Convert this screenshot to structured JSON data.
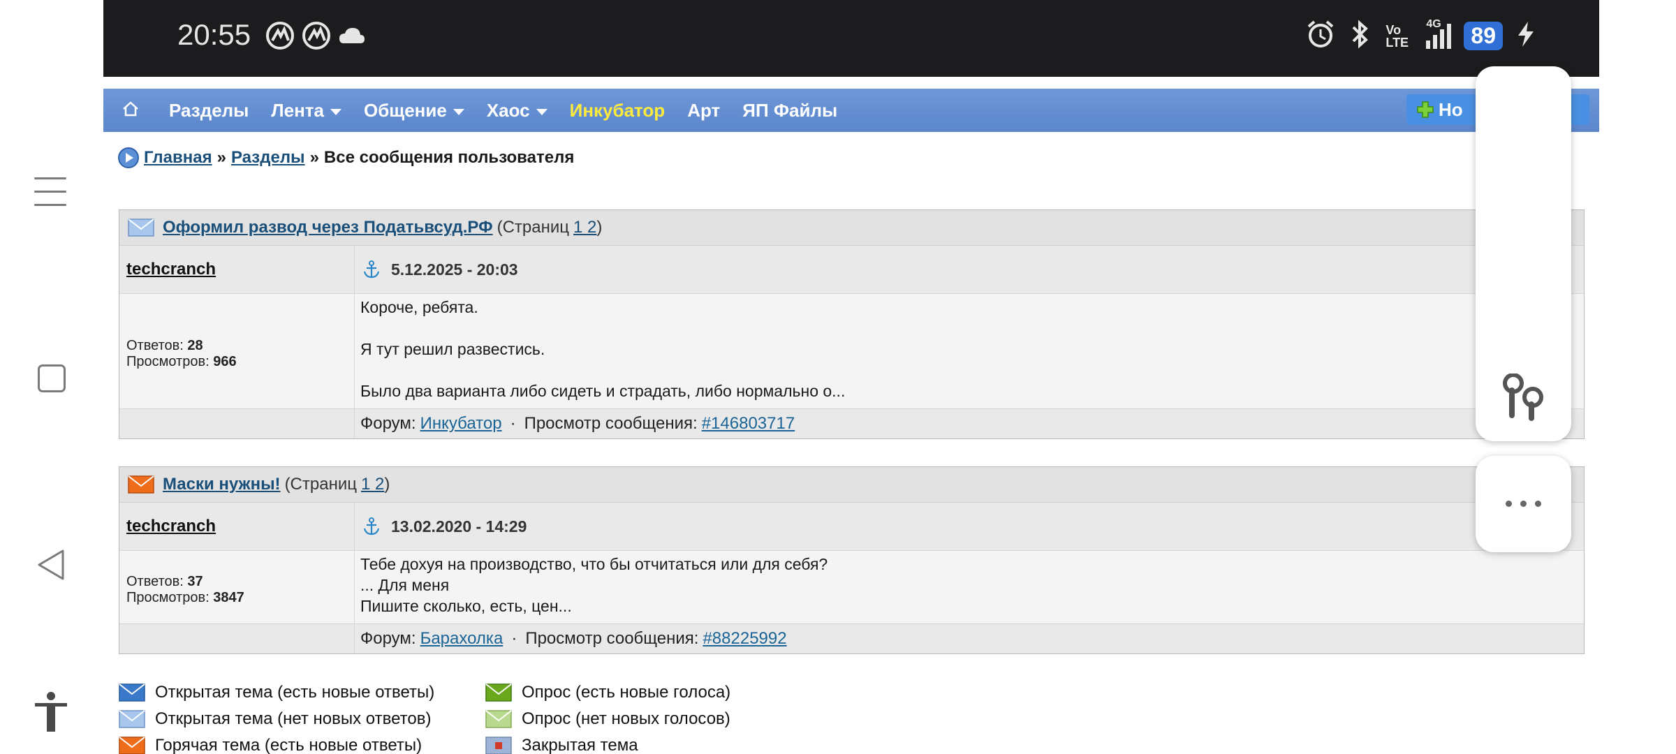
{
  "status_bar": {
    "time": "20:55",
    "network_type": "4G",
    "volte": "Vo\nLTE",
    "battery": "89",
    "icons": [
      "app-icon",
      "app-icon",
      "cloud-icon",
      "alarm-icon",
      "bluetooth-icon",
      "volte-icon",
      "signal-icon",
      "battery-icon",
      "charging-icon"
    ]
  },
  "navbar": {
    "items": [
      {
        "label": "Разделы"
      },
      {
        "label": "Лента"
      },
      {
        "label": "Общение"
      },
      {
        "label": "Хаос"
      },
      {
        "label": "Инкубатор"
      },
      {
        "label": "Арт"
      },
      {
        "label": "ЯП Файлы"
      }
    ],
    "new_button_label": "Но",
    "accent_color": "#ffeb3b"
  },
  "breadcrumb": {
    "home": "Главная",
    "sections": "Разделы",
    "current": "Все сообщения пользователя",
    "sep": "»"
  },
  "topics": [
    {
      "title": "Оформил развод через Податьвсуд.РФ",
      "pages_prefix": "(Страниц",
      "pages": "1 2",
      "pages_suffix": ")",
      "author": "techcranch",
      "datetime": "5.12.2025 - 20:03",
      "replies_label": "Ответов:",
      "replies": "28",
      "views_label": "Просмотров:",
      "views": "966",
      "body_lines": [
        "Короче, ребята.",
        "Я тут решил развестись.",
        "Было два варианта либо сидеть и страдать, либо нормально о..."
      ],
      "forum_label": "Форум:",
      "forum": "Инкубатор",
      "dot": "·",
      "view_label": "Просмотр сообщения:",
      "post_id": "#146803717"
    },
    {
      "title": "Маски нужны!",
      "pages_prefix": "(Страниц",
      "pages": "1 2",
      "pages_suffix": ")",
      "author": "techcranch",
      "datetime": "13.02.2020 - 14:29",
      "replies_label": "Ответов:",
      "replies": "37",
      "views_label": "Просмотров:",
      "views": "3847",
      "body_lines": [
        "Тебе дохуя на производство, что бы отчитаться или для себя?",
        "... Для меня",
        "Пишите сколько, есть, цен..."
      ],
      "forum_label": "Форум:",
      "forum": "Барахолка",
      "dot": "·",
      "view_label": "Просмотр сообщения:",
      "post_id": "#88225992"
    }
  ],
  "legend": [
    {
      "label": "Открытая тема (есть новые ответы)",
      "color": "#3a78c9"
    },
    {
      "label": "Опрос (есть новые голоса)",
      "color": "#6aa81e"
    },
    {
      "label": "Открытая тема (нет новых ответов)",
      "color": "#a8c6ec"
    },
    {
      "label": "Опрос (нет новых голосов)",
      "color": "#b9d98e"
    },
    {
      "label": "Горячая тема (есть новые ответы)",
      "color": "#ef6c1a"
    },
    {
      "label": "Закрытая тема",
      "color": "#9fb4d6"
    }
  ]
}
